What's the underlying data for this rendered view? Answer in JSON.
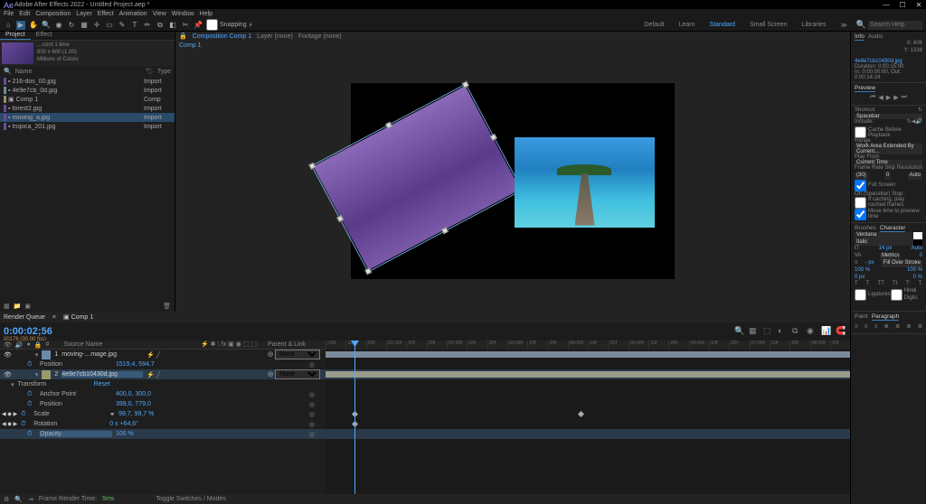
{
  "window": {
    "title": "Adobe After Effects 2022 - Untitled Project.aep *",
    "min": "—",
    "max": "☐",
    "close": "✕"
  },
  "menu": [
    "File",
    "Edit",
    "Composition",
    "Layer",
    "Effect",
    "Animation",
    "View",
    "Window",
    "Help"
  ],
  "toolbar": {
    "snapping": "Snapping",
    "workspaces": [
      "Default",
      "Learn",
      "Standard",
      "Small Screen",
      "Libraries"
    ],
    "active_workspace": "Standard",
    "search_placeholder": "Search Help"
  },
  "project": {
    "tabs": [
      "Project",
      "Effect"
    ],
    "asset_info_line1": "…cord 1 time",
    "asset_info_line2": "800 x 600 (1.00)",
    "asset_info_line3": "Millions of Colors",
    "filter": {
      "name": "Name",
      "type": "Type"
    },
    "items": [
      {
        "color": "#6a4a9a",
        "name": "216-dos_00.jpg",
        "type": "Import"
      },
      {
        "color": "#6a8a9a",
        "name": "4e9e7cb_0d.jpg",
        "type": "Import"
      },
      {
        "color": "#9a8a6a",
        "name": "Comp 1",
        "type": "Comp"
      },
      {
        "color": "#6a4a9a",
        "name": "forest2.jpg",
        "type": "Import"
      },
      {
        "color": "#6a4a9a",
        "name": "moving_a.jpg",
        "type": "Import",
        "selected": true
      },
      {
        "color": "#6a4a9a",
        "name": "tropica_201.jpg",
        "type": "Import"
      }
    ]
  },
  "comp": {
    "tabs_top": {
      "comp_label": "Composition",
      "comp_name": "Comp 1",
      "layer": "Layer (none)",
      "footage": "Footage (none)"
    },
    "tabs_sub": "Comp 1"
  },
  "right": {
    "info": {
      "tab1": "Info",
      "tab2": "Audio",
      "x": "X: 606",
      "y": "Y: 1338",
      "file": "4e9e7cb10430d.jpg",
      "dur": "Duration: 0:00:15:00",
      "io": "In: 0:00:00:00, Out: 0:00:14:24"
    },
    "preview": {
      "title": "Preview"
    },
    "shortcut": {
      "title": "Shortcut",
      "val": "Spacebar",
      "include": "Include:",
      "cache": "Cache Before Playback",
      "range": "Range",
      "range_val": "Work Area Extended By Current…",
      "play_from": "Play From",
      "current_time": "Current Time",
      "frame_rate": "Frame Rate",
      "skip": "Skip",
      "resolution": "Resolution",
      "fr_val": "(30)",
      "skip_val": "0",
      "res_val": "Auto",
      "fullscreen": "Full Screen",
      "onstop": "On (Spacebar) Stop:",
      "opt1": "If caching, play cached frames",
      "opt2": "Move time to preview time"
    },
    "char": {
      "tabs": [
        "Brushes",
        "Character"
      ],
      "font": "Verdana",
      "style": "Italic",
      "size_label": "tT",
      "size": "14 px",
      "leading": "Auto",
      "metrics": "Metrics",
      "va": "VA",
      "va_val": "0",
      "stroke": "Fill Over Stroke",
      "scale1": "100 %",
      "scale2": "100 %",
      "baseline": "0 px",
      "tsume": "0 %",
      "styles": [
        "T",
        "T",
        "TT",
        "Tt",
        "T'",
        "T,",
        "T"
      ],
      "ligatures": "Ligatures",
      "hindi": "Hindi Digits"
    }
  },
  "timeline": {
    "tabs": [
      "Render Queue",
      "Comp 1"
    ],
    "active_tab": "Comp 1",
    "timecode": "0:00:02;56",
    "frame": "00176 (30.00 fps)",
    "header": {
      "source": "Source Name",
      "parent": "Parent & Link"
    },
    "layers": [
      {
        "num": "1",
        "color": "#6a8aaa",
        "name": "moving-…mage.jpg",
        "parent": "None"
      },
      {
        "num": "2",
        "color": "#9a9a6a",
        "name": "4e9e7cb10430d.jpg",
        "parent": "None",
        "selected": true
      }
    ],
    "transform": "Transform",
    "reset": "Reset",
    "props_l1": [
      {
        "name": "Position",
        "val": "1519,4, 594,7"
      }
    ],
    "props_l2": [
      {
        "name": "Anchor Point",
        "val": "400,0, 300,0"
      },
      {
        "name": "Position",
        "val": "399,0, 779,0"
      },
      {
        "name": "Scale",
        "val": "99,7, 99,7 %",
        "keyed": true
      },
      {
        "name": "Rotation",
        "val": "0 x +64,6°",
        "keyed": true
      },
      {
        "name": "Opacity",
        "val": "100 %",
        "selected": true
      }
    ],
    "ruler": [
      ":00f",
      "10f",
      "20f",
      "01:00f",
      "10f",
      "20f",
      "02:00f",
      "10f",
      "20f",
      "03:00f",
      "10f",
      "20f",
      "04:00f",
      "10f",
      "20f",
      "05:00f",
      "10f",
      "20f",
      "06:00f",
      "10f",
      "20f",
      "07:00f",
      "10f",
      "20f",
      "08:00f",
      "10f"
    ],
    "footer": {
      "render_label": "Frame Render Time:",
      "render_time": "5ms",
      "toggle": "Toggle Switches / Modes"
    }
  },
  "bottom_right": {
    "tabs": [
      "Paint",
      "Paragraph"
    ]
  }
}
